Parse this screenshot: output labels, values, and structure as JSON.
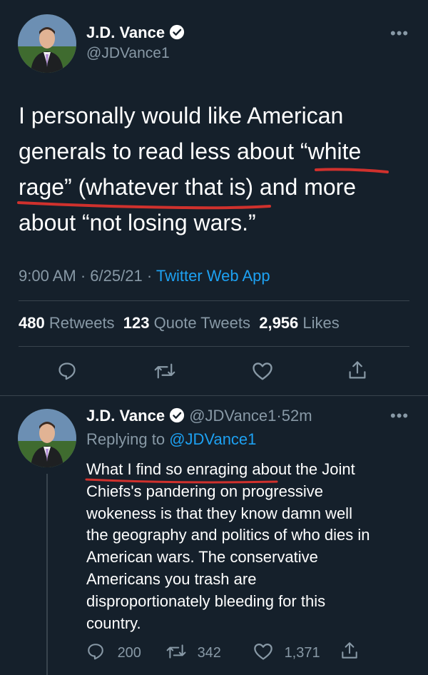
{
  "main_tweet": {
    "author_name": "J.D. Vance",
    "author_handle": "@JDVance1",
    "text_lines": [
      "I personally would like American",
      "generals to read less about “white",
      "rage” (whatever that is) and more",
      "about “not losing wars.”"
    ],
    "time": "9:00 AM",
    "date": "6/25/21",
    "source": "Twitter Web App",
    "stats": {
      "retweets_count": "480",
      "retweets_label": "Retweets",
      "quotes_count": "123",
      "quotes_label": "Quote Tweets",
      "likes_count": "2,956",
      "likes_label": "Likes"
    }
  },
  "reply_tweet": {
    "author_name": "J.D. Vance",
    "author_handle": "@JDVance1",
    "age": "52m",
    "replying_to_label": "Replying to",
    "replying_to_handle": "@JDVance1",
    "text_lines": [
      "What I find so enraging about the Joint",
      "Chiefs's pandering on progressive",
      "wokeness is that they know damn well",
      "the geography and politics of who dies in",
      "American wars. The conservative",
      "Americans you trash are",
      "disproportionately bleeding for this",
      "country."
    ],
    "actions": {
      "replies": "200",
      "retweets": "342",
      "likes": "1,371"
    }
  },
  "symbols": {
    "more": "•••",
    "dot_sep": "·"
  },
  "colors": {
    "background": "#15202b",
    "link": "#1da1f2",
    "muted": "#8899a6",
    "underline": "#d0312d"
  }
}
